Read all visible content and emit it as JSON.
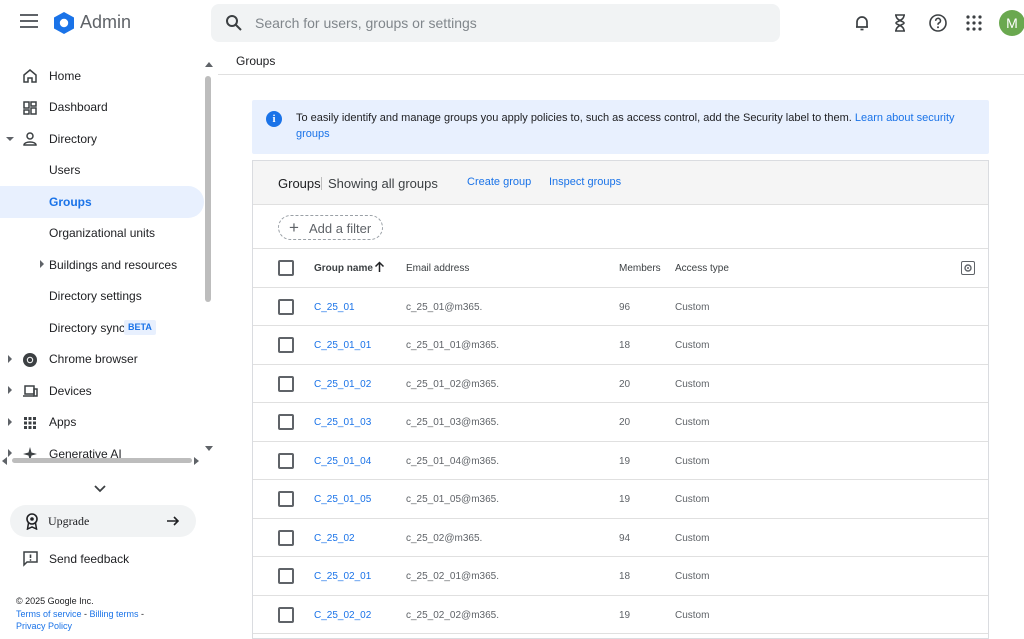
{
  "topbar": {
    "brand": "Admin",
    "search_placeholder": "Search for users, groups or settings",
    "avatar_letter": "M",
    "icons": [
      "menu-icon",
      "admin-logo-icon",
      "search-icon",
      "bell-icon",
      "hourglass-icon",
      "help-icon",
      "apps-grid-icon"
    ]
  },
  "sidebar": {
    "items": [
      {
        "label": "Home",
        "icon": "home-icon"
      },
      {
        "label": "Dashboard",
        "icon": "dashboard-icon"
      },
      {
        "label": "Directory",
        "icon": "person-icon",
        "expanded": true
      },
      {
        "label": "Users"
      },
      {
        "label": "Groups",
        "active": true
      },
      {
        "label": "Organizational units"
      },
      {
        "label": "Buildings and resources"
      },
      {
        "label": "Directory settings"
      },
      {
        "label": "Directory sync",
        "badge": "BETA"
      },
      {
        "label": "Chrome browser",
        "icon": "chrome-icon"
      },
      {
        "label": "Devices",
        "icon": "devices-icon"
      },
      {
        "label": "Apps",
        "icon": "apps-icon"
      },
      {
        "label": "Generative AI",
        "icon": "sparkle-icon"
      }
    ],
    "upgrade_label": "Upgrade",
    "feedback_label": "Send feedback",
    "footer": {
      "copyright": "© 2025 Google Inc.",
      "terms": "Terms of service",
      "billing": "Billing terms",
      "privacy": "Privacy Policy"
    }
  },
  "main": {
    "breadcrumb": "Groups",
    "banner": {
      "text": "To easily identify and manage groups you apply policies to, such as access control, add the Security label to them.",
      "link": "Learn about security groups"
    },
    "card": {
      "title": "Groups",
      "subtitle": "Showing all groups",
      "create": "Create group",
      "inspect": "Inspect groups",
      "add_filter": "Add a filter"
    },
    "table": {
      "headers": {
        "name": "Group name",
        "email": "Email address",
        "members": "Members",
        "access": "Access type"
      },
      "rows": [
        {
          "name": "C_25_01",
          "email": "c_25_01@m365.",
          "members": "96",
          "access": "Custom"
        },
        {
          "name": "C_25_01_01",
          "email": "c_25_01_01@m365.",
          "members": "18",
          "access": "Custom"
        },
        {
          "name": "C_25_01_02",
          "email": "c_25_01_02@m365.",
          "members": "20",
          "access": "Custom"
        },
        {
          "name": "C_25_01_03",
          "email": "c_25_01_03@m365.",
          "members": "20",
          "access": "Custom"
        },
        {
          "name": "C_25_01_04",
          "email": "c_25_01_04@m365.",
          "members": "19",
          "access": "Custom"
        },
        {
          "name": "C_25_01_05",
          "email": "c_25_01_05@m365.",
          "members": "19",
          "access": "Custom"
        },
        {
          "name": "C_25_02",
          "email": "c_25_02@m365.",
          "members": "94",
          "access": "Custom"
        },
        {
          "name": "C_25_02_01",
          "email": "c_25_02_01@m365.",
          "members": "18",
          "access": "Custom"
        },
        {
          "name": "C_25_02_02",
          "email": "c_25_02_02@m365.",
          "members": "19",
          "access": "Custom"
        }
      ]
    }
  },
  "colors": {
    "accent": "#1a73e8",
    "active_bg": "#e8f0fe",
    "avatar": "#6aa84f"
  }
}
